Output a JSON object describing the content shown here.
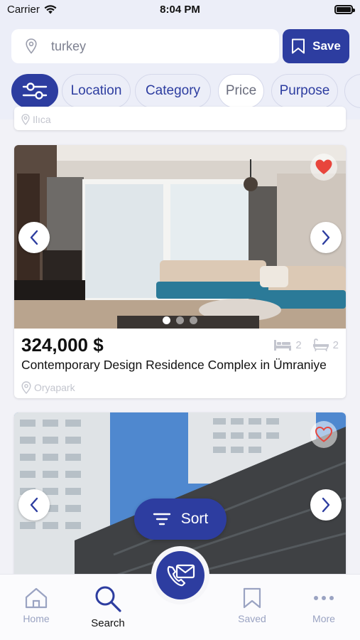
{
  "status": {
    "carrier": "Carrier",
    "time": "8:04 PM"
  },
  "search": {
    "query": "turkey",
    "save_label": "Save"
  },
  "filters": {
    "chips": [
      "Location",
      "Category",
      "Price",
      "Purpose"
    ]
  },
  "previous_listing": {
    "location": "Ilıca"
  },
  "listing": {
    "price": "324,000 $",
    "title": "Contemporary Design Residence Complex in Ümraniye",
    "location": "Oryapark",
    "bedrooms": "2",
    "bathrooms": "2",
    "favorited": true,
    "photo_index": 1,
    "photo_count": 3
  },
  "listing2": {
    "favorited": false
  },
  "sort_label": "Sort",
  "tabs": {
    "home": "Home",
    "search": "Search",
    "saved": "Saved",
    "more": "More"
  },
  "colors": {
    "primary": "#2d3da0",
    "heart": "#e8453c",
    "muted": "#c3c5ce"
  }
}
